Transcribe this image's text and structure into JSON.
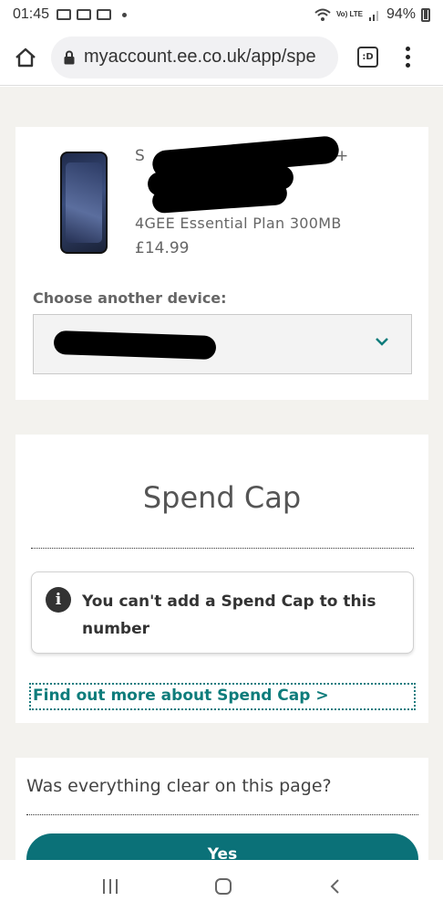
{
  "status_bar": {
    "time": "01:45",
    "network": "Vo) LTE",
    "battery": "94%"
  },
  "browser": {
    "url": "myaccount.ee.co.uk/app/spe",
    "tabs_label": ":D"
  },
  "device": {
    "name_visible": "S",
    "name_suffix": "+",
    "plan": "4GEE Essential Plan 300MB",
    "price": "£14.99",
    "choose_label": "Choose another device:"
  },
  "spend_cap": {
    "title": "Spend Cap",
    "notice": "You can't add a Spend Cap to this number",
    "link": "Find out more about Spend Cap >"
  },
  "feedback": {
    "question": "Was everything clear on this page?",
    "yes_label": "Yes"
  },
  "colors": {
    "accent": "#0b7178",
    "page_background": "#f3f2ee"
  }
}
